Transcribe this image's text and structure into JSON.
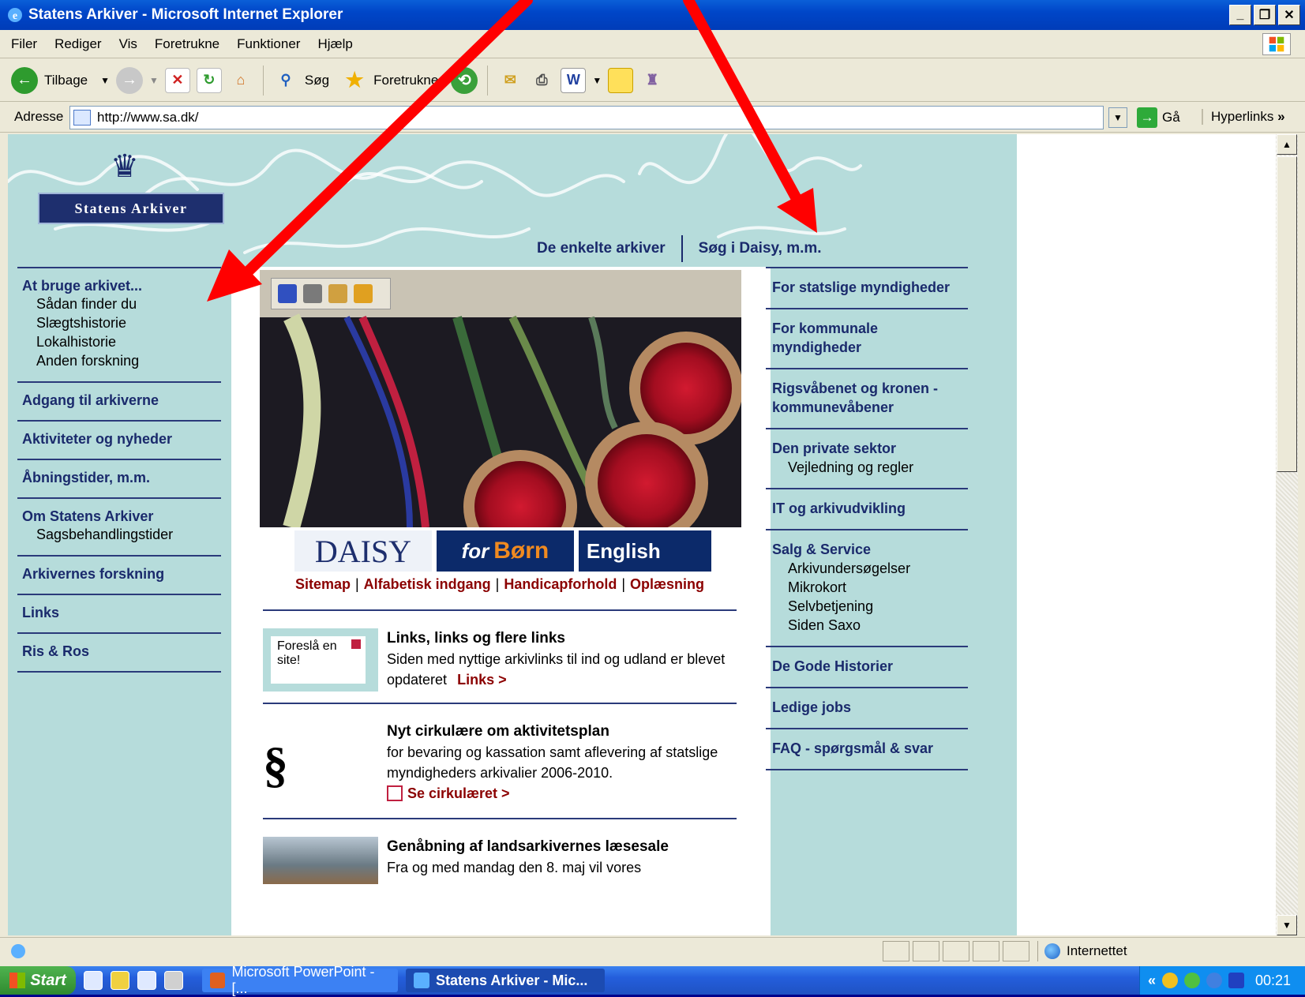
{
  "window": {
    "title": "Statens Arkiver - Microsoft Internet Explorer"
  },
  "menu": [
    "Filer",
    "Rediger",
    "Vis",
    "Foretrukne",
    "Funktioner",
    "Hjælp"
  ],
  "toolbar": {
    "back_label": "Tilbage",
    "search_label": "Søg",
    "favorites_label": "Foretrukne"
  },
  "address": {
    "label": "Adresse",
    "url": "http://www.sa.dk/",
    "go_label": "Gå",
    "links_label": "Hyperlinks"
  },
  "site": {
    "logo_text": "Statens Arkiver",
    "topnav": [
      "De enkelte arkiver",
      "Søg i Daisy, m.m."
    ],
    "leftnav": [
      {
        "head": "At bruge arkivet...",
        "subs": [
          "Sådan finder du",
          "Slægtshistorie",
          "Lokalhistorie",
          "Anden forskning"
        ]
      },
      {
        "head": "Adgang til arkiverne",
        "subs": []
      },
      {
        "head": "Aktiviteter og nyheder",
        "subs": []
      },
      {
        "head": "Åbningstider, m.m.",
        "subs": []
      },
      {
        "head": "Om Statens Arkiver",
        "subs": [
          "Sagsbehandlingstider"
        ]
      },
      {
        "head": "Arkivernes forskning",
        "subs": []
      },
      {
        "head": "Links",
        "subs": []
      },
      {
        "head": "Ris & Ros",
        "subs": []
      }
    ],
    "rightnav": [
      {
        "head": "For statslige myndigheder",
        "subs": []
      },
      {
        "head": "For kommunale myndigheder",
        "subs": []
      },
      {
        "head": "Rigsvåbenet og kronen - kommunevåbener",
        "subs": []
      },
      {
        "head": "Den private sektor",
        "subs": [
          "Vejledning og regler"
        ]
      },
      {
        "head": "IT og arkivudvikling",
        "subs": []
      },
      {
        "head": "Salg & Service",
        "subs": [
          "Arkivundersøgelser",
          "Mikrokort",
          "Selvbetjening",
          "Siden Saxo"
        ]
      },
      {
        "head": "De Gode Historier",
        "subs": []
      },
      {
        "head": "Ledige jobs",
        "subs": []
      },
      {
        "head": "FAQ - spørgsmål & svar",
        "subs": []
      }
    ],
    "promo": {
      "daisy": "DAISY",
      "for": "for",
      "born": "Børn",
      "english": "English"
    },
    "footer_links": [
      "Sitemap",
      "Alfabetisk indgang",
      "Handicapforhold",
      "Oplæsning"
    ],
    "news": [
      {
        "title": "Links, links og flere links",
        "body": "Siden med nyttige arkivlinks til ind og udland er blevet opdateret",
        "more": "Links >",
        "thumb_text": "Foreslå en site!"
      },
      {
        "title": "Nyt cirkulære om aktivitetsplan",
        "body": "for bevaring og kassation samt aflevering af statslige myndigheders arkivalier 2006-2010.",
        "more": "Se cirkulæret >",
        "thumb_text": "§"
      },
      {
        "title": "Genåbning af landsarkivernes læsesale",
        "body": "Fra og med mandag den 8. maj vil vores",
        "more": "",
        "thumb_text": ""
      }
    ]
  },
  "statusbar": {
    "zone": "Internettet"
  },
  "taskbar": {
    "start_label": "Start",
    "tasks": [
      "Microsoft PowerPoint - [...",
      "Statens Arkiver - Mic..."
    ],
    "time": "00:21"
  },
  "colors": {
    "site_bg": "#b6dcdb",
    "nav_blue": "#1a2a6c",
    "link_red": "#8b0000",
    "arrow_red": "#ff0000"
  }
}
